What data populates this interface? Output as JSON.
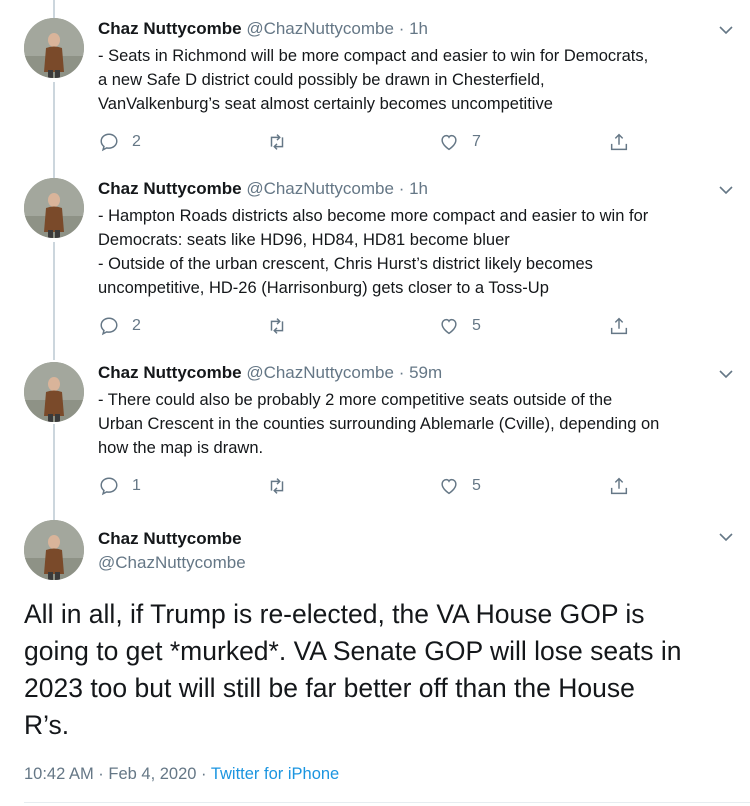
{
  "author": {
    "name": "Chaz Nuttycombe",
    "handle": "@ChazNuttycombe"
  },
  "replies": [
    {
      "time": "1h",
      "lines": [
        "- Seats in Richmond will be more compact and easier to win for Democrats,",
        "a new Safe D district could possibly be drawn in Chesterfield,",
        "VanValkenburg’s seat almost certainly becomes uncompetitive"
      ],
      "reply_count": "2",
      "retweet_count": "",
      "like_count": "7"
    },
    {
      "time": "1h",
      "lines": [
        "- Hampton Roads districts also become more compact and easier to win for",
        "Democrats: seats like HD96, HD84, HD81 become bluer",
        "- Outside of the urban crescent, Chris Hurst’s district likely becomes",
        "uncompetitive, HD-26 (Harrisonburg) gets closer to a Toss-Up"
      ],
      "reply_count": "2",
      "retweet_count": "",
      "like_count": "5"
    },
    {
      "time": "59m",
      "lines": [
        "- There could also be probably 2 more competitive seats outside of the",
        "Urban Crescent in the counties surrounding Ablemarle (Cville), depending on",
        "how the map is drawn."
      ],
      "reply_count": "1",
      "retweet_count": "",
      "like_count": "5"
    }
  ],
  "main_tweet": {
    "lines": [
      "All in all, if Trump is re-elected, the VA House GOP is",
      "going to get *murked*. VA Senate GOP will lose seats in",
      "2023 too but will still be far better off than the House",
      "R’s."
    ],
    "timestamp": "10:42 AM · Feb 4, 2020",
    "meta_separator": " · ",
    "source": "Twitter for iPhone"
  },
  "separator": " · ",
  "icons": {
    "reply": "reply-icon",
    "retweet": "retweet-icon",
    "like": "heart-icon",
    "share": "share-icon",
    "menu": "chevron-down-icon"
  },
  "colors": {
    "text": "#14171a",
    "secondary": "#657786",
    "link": "#1b95e0",
    "thread_line": "#ccd6dd"
  }
}
